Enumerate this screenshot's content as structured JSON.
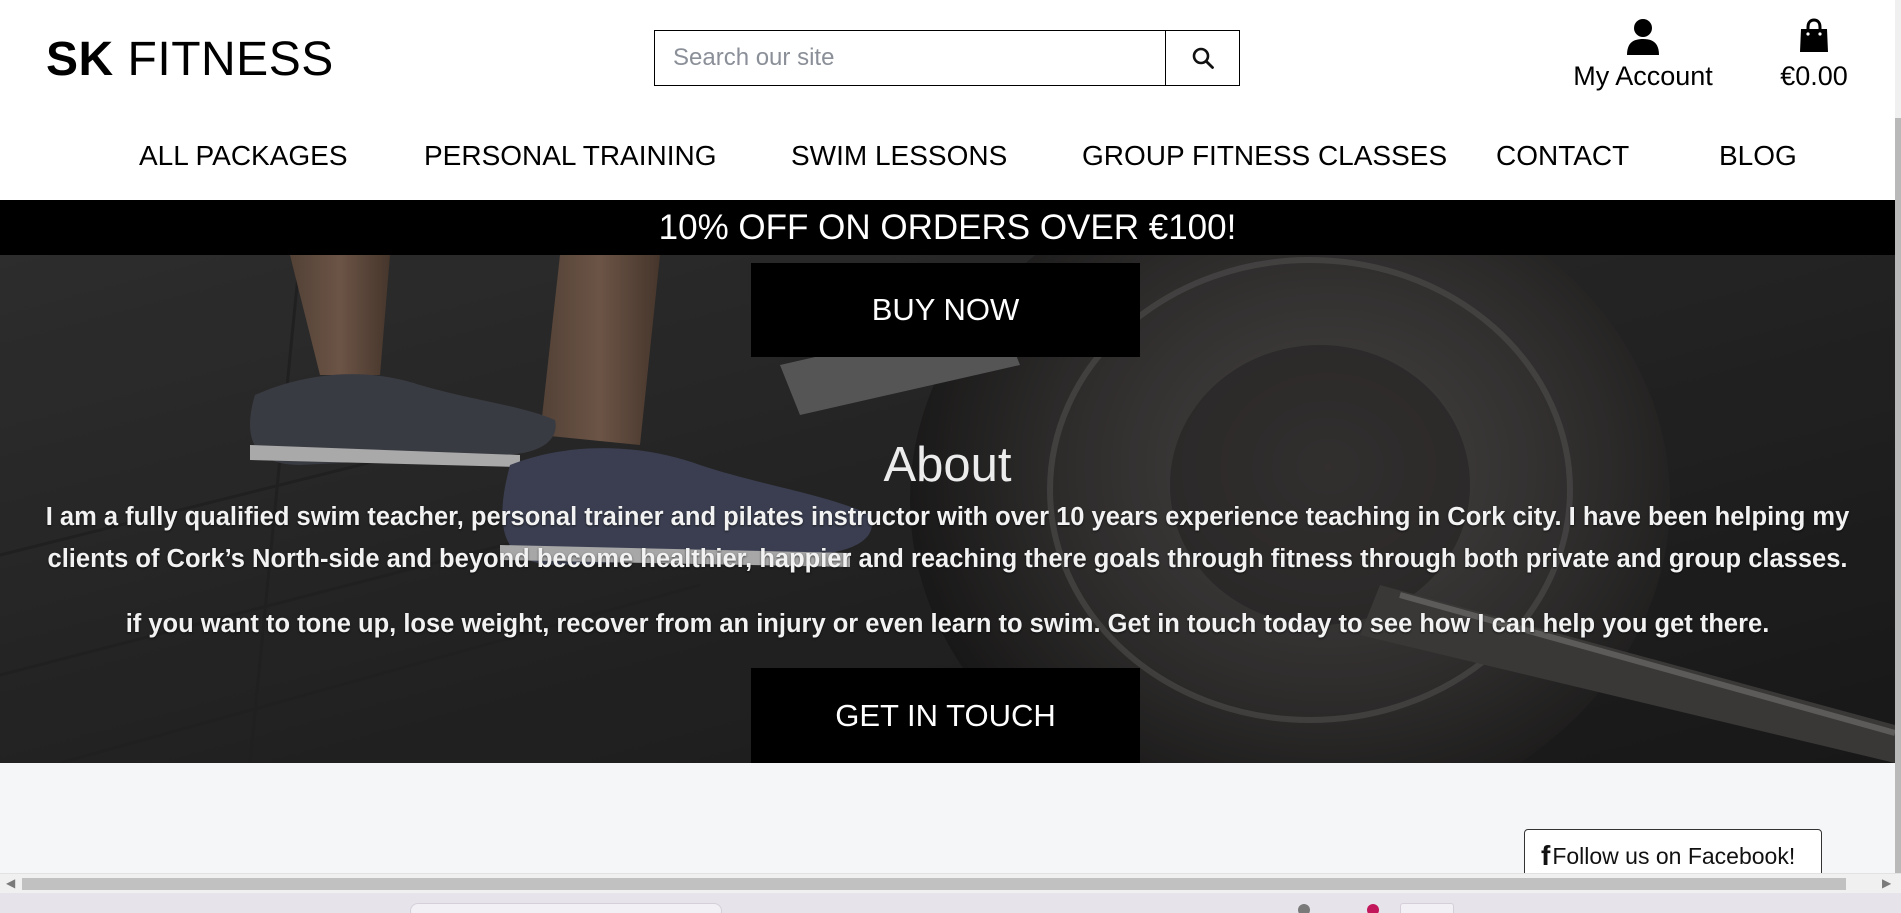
{
  "header": {
    "logo_bold": "SK",
    "logo_light": "FITNESS",
    "search_placeholder": "Search our site",
    "search_icon": "search-icon",
    "account_label": "My Account",
    "account_icon": "user-icon",
    "cart_total": "€0.00",
    "cart_icon": "shopping-bag-icon"
  },
  "nav": {
    "items": [
      {
        "label": "ALL PACKAGES"
      },
      {
        "label": "PERSONAL TRAINING"
      },
      {
        "label": "SWIM LESSONS"
      },
      {
        "label": "GROUP FITNESS CLASSES"
      },
      {
        "label": "CONTACT"
      },
      {
        "label": "BLOG"
      }
    ]
  },
  "promo": {
    "text": "10% OFF ON ORDERS OVER €100!"
  },
  "hero": {
    "buy_label": "BUY NOW",
    "title": "About",
    "paragraph1": "I am a fully qualified swim teacher, personal trainer and pilates instructor with over 10 years experience teaching in Cork city. I have been helping my clients of Cork’s North-side and beyond become healthier, happier and reaching there goals through fitness through both private and group classes.",
    "paragraph2": "if you want to tone up, lose weight, recover from an injury or even learn to swim. Get in touch today to see how I can help you get there.",
    "contact_label": "GET IN TOUCH"
  },
  "footer": {
    "facebook_icon": "facebook-icon",
    "facebook_glyph": "f",
    "facebook_label": "Follow us on Facebook!"
  },
  "colors": {
    "brand": "#000000",
    "banner_text": "#ffffff",
    "page_background": "#f5f6f8"
  }
}
